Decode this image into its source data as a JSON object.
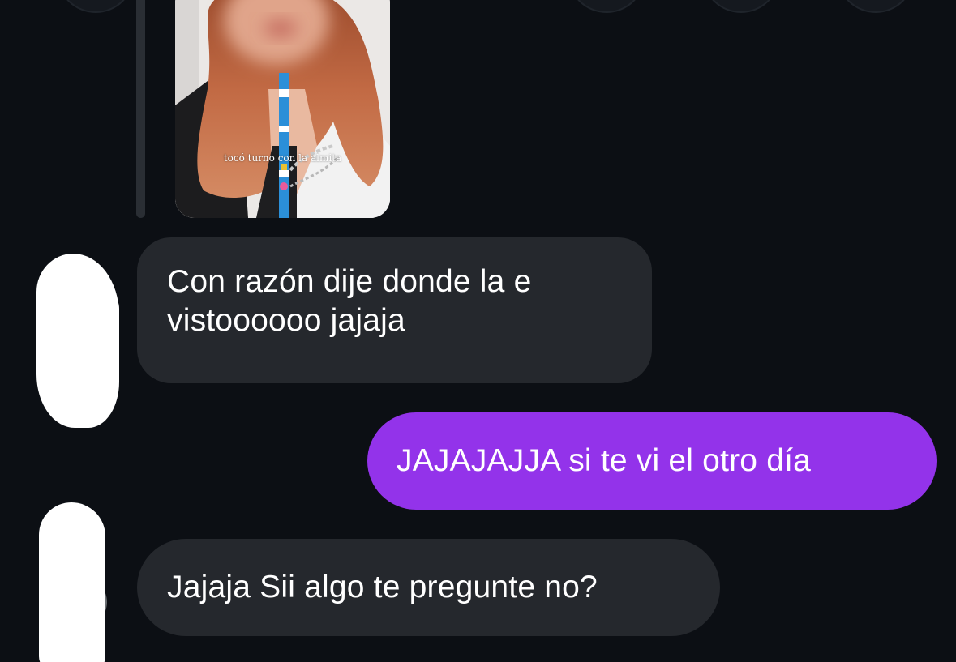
{
  "story": {
    "caption": "tocó turno con la almita"
  },
  "messages": [
    {
      "sender": "other",
      "text_line1": "Con razón dije donde la e",
      "text_line2": "vistoooooo jajaja"
    },
    {
      "sender": "me",
      "text": "JAJAJAJJA si te vi el otro día"
    },
    {
      "sender": "other",
      "text": "Jajaja Sii algo te pregunte no?"
    }
  ],
  "colors": {
    "background": "#0c0f14",
    "incoming_bubble": "#25282d",
    "outgoing_bubble": "#9333ea"
  }
}
